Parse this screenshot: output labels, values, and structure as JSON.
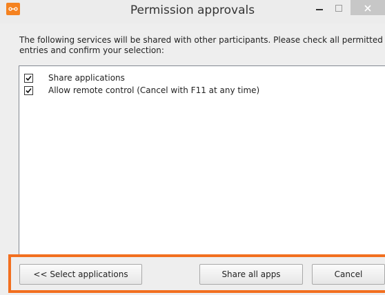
{
  "window": {
    "title": "Permission approvals",
    "controls": {
      "minimize_icon": "minimize-icon",
      "maximize_icon": "maximize-icon",
      "close_icon": "close-icon"
    }
  },
  "intro_text": "The following services will be shared with other participants. Please check all permitted entries and confirm your selection:",
  "permissions": [
    {
      "label": "Share applications",
      "checked": true
    },
    {
      "label": "Allow remote control (Cancel with F11 at any time)",
      "checked": true
    }
  ],
  "buttons": {
    "select_applications": "<< Select applications",
    "share_all_apps": "Share all apps",
    "cancel": "Cancel"
  },
  "colors": {
    "accent": "#f58220",
    "highlight_border": "#f26f1f"
  }
}
